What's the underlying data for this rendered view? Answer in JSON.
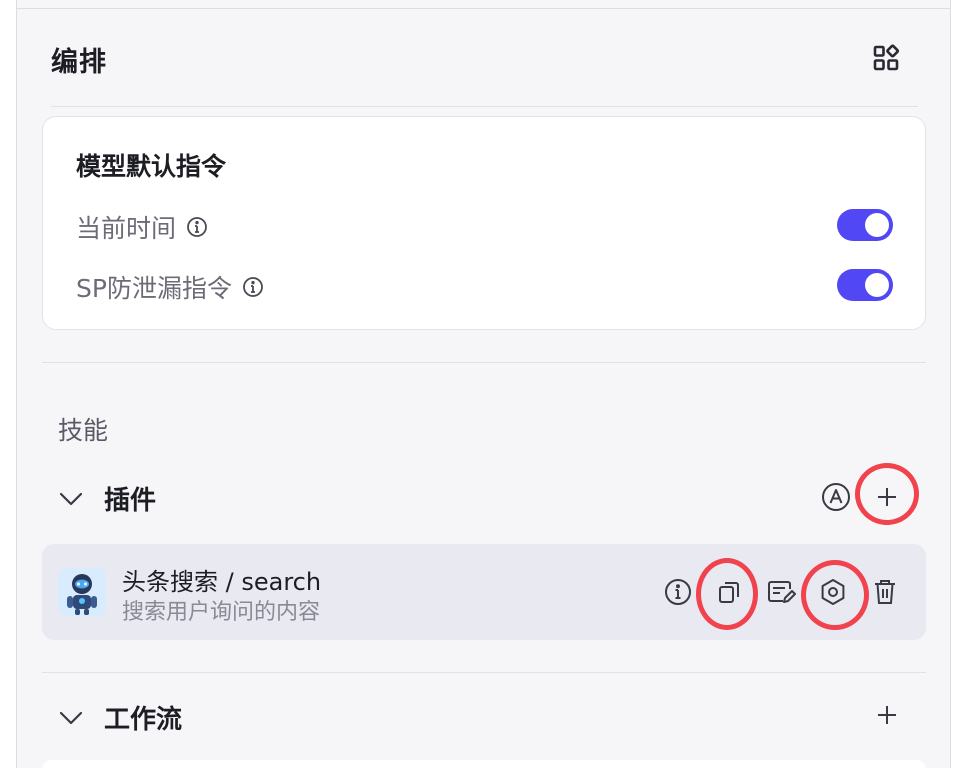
{
  "header": {
    "title": "编排",
    "layout_icon": "layout-grid-icon"
  },
  "model_card": {
    "title": "模型默认指令",
    "settings": [
      {
        "label": "当前时间",
        "icon": "info-icon",
        "enabled": true
      },
      {
        "label": "SP防泄漏指令",
        "icon": "info-icon",
        "enabled": true
      }
    ]
  },
  "skills": {
    "section_label": "技能",
    "plugins": {
      "label": "插件",
      "icons": [
        "chevron-down-icon",
        "auto-a-icon",
        "plus-icon"
      ],
      "items": [
        {
          "name": "头条搜索 / search",
          "description": "搜索用户询问的内容",
          "avatar": "robot-avatar",
          "actions": [
            "info-icon",
            "copy-icon",
            "edit-icon",
            "settings-icon",
            "trash-icon"
          ]
        }
      ]
    },
    "workflow": {
      "label": "工作流",
      "icons": [
        "chevron-down-icon",
        "plus-icon"
      ]
    }
  },
  "colors": {
    "accent": "#5147f5",
    "annotation": "#f0434d",
    "background": "#f6f6f9",
    "card": "#ffffff",
    "plugin_item_bg": "#e9e9f2"
  }
}
